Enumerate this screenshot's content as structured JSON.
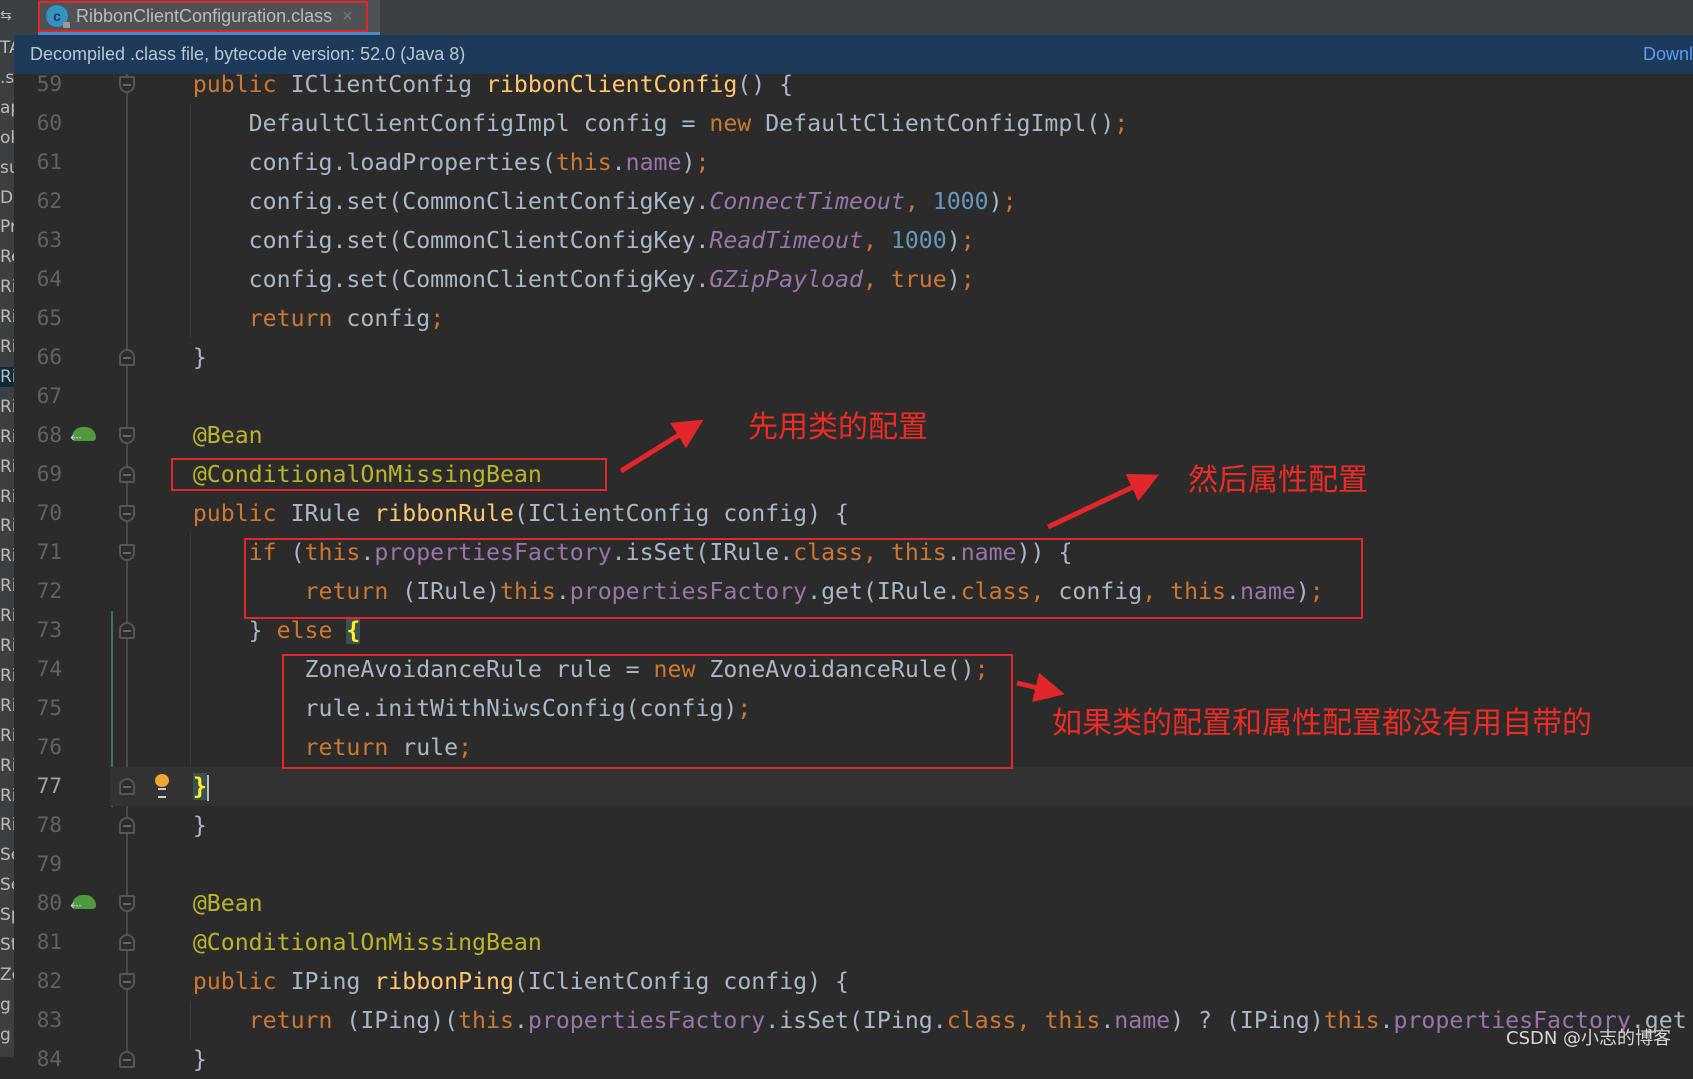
{
  "sidebar_fragments": [
    "TA",
    ".s",
    "ap",
    "ok",
    "su",
    "De",
    "Pr",
    "Re",
    "Ri",
    "Ri",
    "Ri",
    "Ri",
    "Ri",
    "Ri",
    "Ri",
    "Ri",
    "Ri",
    "Ri",
    "Ri",
    "Ri",
    "Ri",
    "Ri",
    "Ri",
    "Ri",
    "Ri",
    "Ri",
    "Ri",
    "Se",
    "Se",
    "Sp",
    "St",
    "Zo",
    "g",
    "g"
  ],
  "sidebar_selected_index": 11,
  "tab": {
    "label": "RibbonClientConfiguration.class",
    "icon": "class-c-icon",
    "close": "×"
  },
  "infobar": {
    "text": "Decompiled .class file, bytecode version: 52.0 (Java 8)",
    "link": "Downl"
  },
  "current_line": 77,
  "code_lines": [
    {
      "num": "59",
      "fold": "fold-open",
      "tokens": [
        [
          "",
          "    "
        ],
        [
          "k",
          "public"
        ],
        [
          "",
          " IClientConfig "
        ],
        [
          "m",
          "ribbonClientConfig"
        ],
        [
          "",
          "() {"
        ]
      ]
    },
    {
      "num": "60",
      "tokens": [
        [
          "",
          "        DefaultClientConfigImpl config = "
        ],
        [
          "k",
          "new"
        ],
        [
          "",
          " DefaultClientConfigImpl()"
        ],
        [
          "k",
          ";"
        ]
      ]
    },
    {
      "num": "61",
      "tokens": [
        [
          "",
          "        config.loadProperties("
        ],
        [
          "k",
          "this"
        ],
        [
          "",
          "."
        ],
        [
          "f",
          "name"
        ],
        [
          "",
          ")"
        ],
        [
          "k",
          ";"
        ]
      ]
    },
    {
      "num": "62",
      "tokens": [
        [
          "",
          "        config.set(CommonClientConfigKey."
        ],
        [
          "s",
          "ConnectTimeout"
        ],
        [
          "k",
          ","
        ],
        [
          "",
          " "
        ],
        [
          "n",
          "1000"
        ],
        [
          "",
          ")"
        ],
        [
          "k",
          ";"
        ]
      ]
    },
    {
      "num": "63",
      "tokens": [
        [
          "",
          "        config.set(CommonClientConfigKey."
        ],
        [
          "s",
          "ReadTimeout"
        ],
        [
          "k",
          ","
        ],
        [
          "",
          " "
        ],
        [
          "n",
          "1000"
        ],
        [
          "",
          ")"
        ],
        [
          "k",
          ";"
        ]
      ]
    },
    {
      "num": "64",
      "tokens": [
        [
          "",
          "        config.set(CommonClientConfigKey."
        ],
        [
          "s",
          "GZipPayload"
        ],
        [
          "k",
          ","
        ],
        [
          "",
          " "
        ],
        [
          "k",
          "true"
        ],
        [
          "",
          ")"
        ],
        [
          "k",
          ";"
        ]
      ]
    },
    {
      "num": "65",
      "tokens": [
        [
          "",
          "        "
        ],
        [
          "k",
          "return"
        ],
        [
          "",
          " config"
        ],
        [
          "k",
          ";"
        ]
      ]
    },
    {
      "num": "66",
      "fold": "fold-close",
      "tokens": [
        [
          "",
          "    }"
        ]
      ]
    },
    {
      "num": "67",
      "tokens": []
    },
    {
      "num": "68",
      "fold": "fold-open",
      "gutter": "spring-bean-icon",
      "tokens": [
        [
          "a",
          "    @Bean"
        ]
      ]
    },
    {
      "num": "69",
      "fold": "fold-close",
      "tokens": [
        [
          "a",
          "    @ConditionalOnMissingBean"
        ]
      ]
    },
    {
      "num": "70",
      "fold": "fold-open",
      "tokens": [
        [
          "",
          "    "
        ],
        [
          "k",
          "public"
        ],
        [
          "",
          " IRule "
        ],
        [
          "m",
          "ribbonRule"
        ],
        [
          "",
          "(IClientConfig config) {"
        ]
      ]
    },
    {
      "num": "71",
      "fold": "fold-open",
      "tokens": [
        [
          "",
          "        "
        ],
        [
          "k",
          "if"
        ],
        [
          "",
          " ("
        ],
        [
          "k",
          "this"
        ],
        [
          "",
          "."
        ],
        [
          "f",
          "propertiesFactory"
        ],
        [
          "",
          ".isSet(IRule."
        ],
        [
          "k",
          "class"
        ],
        [
          "k",
          ","
        ],
        [
          "",
          " "
        ],
        [
          "k",
          "this"
        ],
        [
          "",
          "."
        ],
        [
          "f",
          "name"
        ],
        [
          "",
          ")) {"
        ]
      ]
    },
    {
      "num": "72",
      "tokens": [
        [
          "",
          "            "
        ],
        [
          "k",
          "return"
        ],
        [
          "",
          " (IRule)"
        ],
        [
          "k",
          "this"
        ],
        [
          "",
          "."
        ],
        [
          "f",
          "propertiesFactory"
        ],
        [
          "",
          ".get(IRule."
        ],
        [
          "k",
          "class"
        ],
        [
          "k",
          ","
        ],
        [
          "",
          " config"
        ],
        [
          "k",
          ","
        ],
        [
          "",
          " "
        ],
        [
          "k",
          "this"
        ],
        [
          "",
          "."
        ],
        [
          "f",
          "name"
        ],
        [
          "",
          ")"
        ],
        [
          "k",
          ";"
        ]
      ]
    },
    {
      "num": "73",
      "fold": "fold-close",
      "tokens": [
        [
          "",
          "        } "
        ],
        [
          "k",
          "else"
        ],
        [
          "",
          " "
        ],
        [
          "b",
          "{"
        ]
      ]
    },
    {
      "num": "74",
      "tokens": [
        [
          "",
          "            ZoneAvoidanceRule rule = "
        ],
        [
          "k",
          "new"
        ],
        [
          "",
          " ZoneAvoidanceRule()"
        ],
        [
          "k",
          ";"
        ]
      ]
    },
    {
      "num": "75",
      "tokens": [
        [
          "",
          "            rule.initWithNiwsConfig(config)"
        ],
        [
          "k",
          ";"
        ]
      ]
    },
    {
      "num": "76",
      "tokens": [
        [
          "",
          "            "
        ],
        [
          "k",
          "return"
        ],
        [
          "",
          " rule"
        ],
        [
          "k",
          ";"
        ]
      ]
    },
    {
      "num": "77",
      "fold": "fold-close",
      "gutter": "lightbulb-icon",
      "tokens": [
        [
          "",
          "    "
        ],
        [
          "b",
          "}"
        ]
      ]
    },
    {
      "num": "78",
      "fold": "fold-close",
      "tokens": [
        [
          "",
          "    }"
        ]
      ]
    },
    {
      "num": "79",
      "tokens": []
    },
    {
      "num": "80",
      "fold": "fold-open",
      "gutter": "spring-bean-icon",
      "tokens": [
        [
          "a",
          "    @Bean"
        ]
      ]
    },
    {
      "num": "81",
      "fold": "fold-close",
      "tokens": [
        [
          "a",
          "    @ConditionalOnMissingBean"
        ]
      ]
    },
    {
      "num": "82",
      "fold": "fold-open",
      "tokens": [
        [
          "",
          "    "
        ],
        [
          "k",
          "public"
        ],
        [
          "",
          " IPing "
        ],
        [
          "m",
          "ribbonPing"
        ],
        [
          "",
          "(IClientConfig config) {"
        ]
      ]
    },
    {
      "num": "83",
      "tokens": [
        [
          "",
          "        "
        ],
        [
          "k",
          "return"
        ],
        [
          "",
          " (IPing)("
        ],
        [
          "k",
          "this"
        ],
        [
          "",
          "."
        ],
        [
          "f",
          "propertiesFactory"
        ],
        [
          "",
          ".isSet(IPing."
        ],
        [
          "k",
          "class"
        ],
        [
          "k",
          ","
        ],
        [
          "",
          " "
        ],
        [
          "k",
          "this"
        ],
        [
          "",
          "."
        ],
        [
          "f",
          "name"
        ],
        [
          "",
          ") ? (IPing)"
        ],
        [
          "k",
          "this"
        ],
        [
          "",
          "."
        ],
        [
          "f",
          "propertiesFactory"
        ],
        [
          "",
          ".get"
        ]
      ]
    },
    {
      "num": "84",
      "fold": "fold-close",
      "tokens": [
        [
          "",
          "    }"
        ]
      ]
    }
  ],
  "annotations": {
    "note1": "先用类的配置",
    "note2": "然后属性配置",
    "note3": "如果类的配置和属性配置都没有用自带的",
    "color": "#e3262a"
  },
  "watermark": "CSDN @小志的博客",
  "colors": {
    "background": "#2b2b2b",
    "keyword": "#cc7832",
    "annotation": "#bbb529",
    "field": "#9876aa",
    "number": "#6897bb",
    "method": "#ffc66d",
    "text": "#a9b7c6"
  }
}
